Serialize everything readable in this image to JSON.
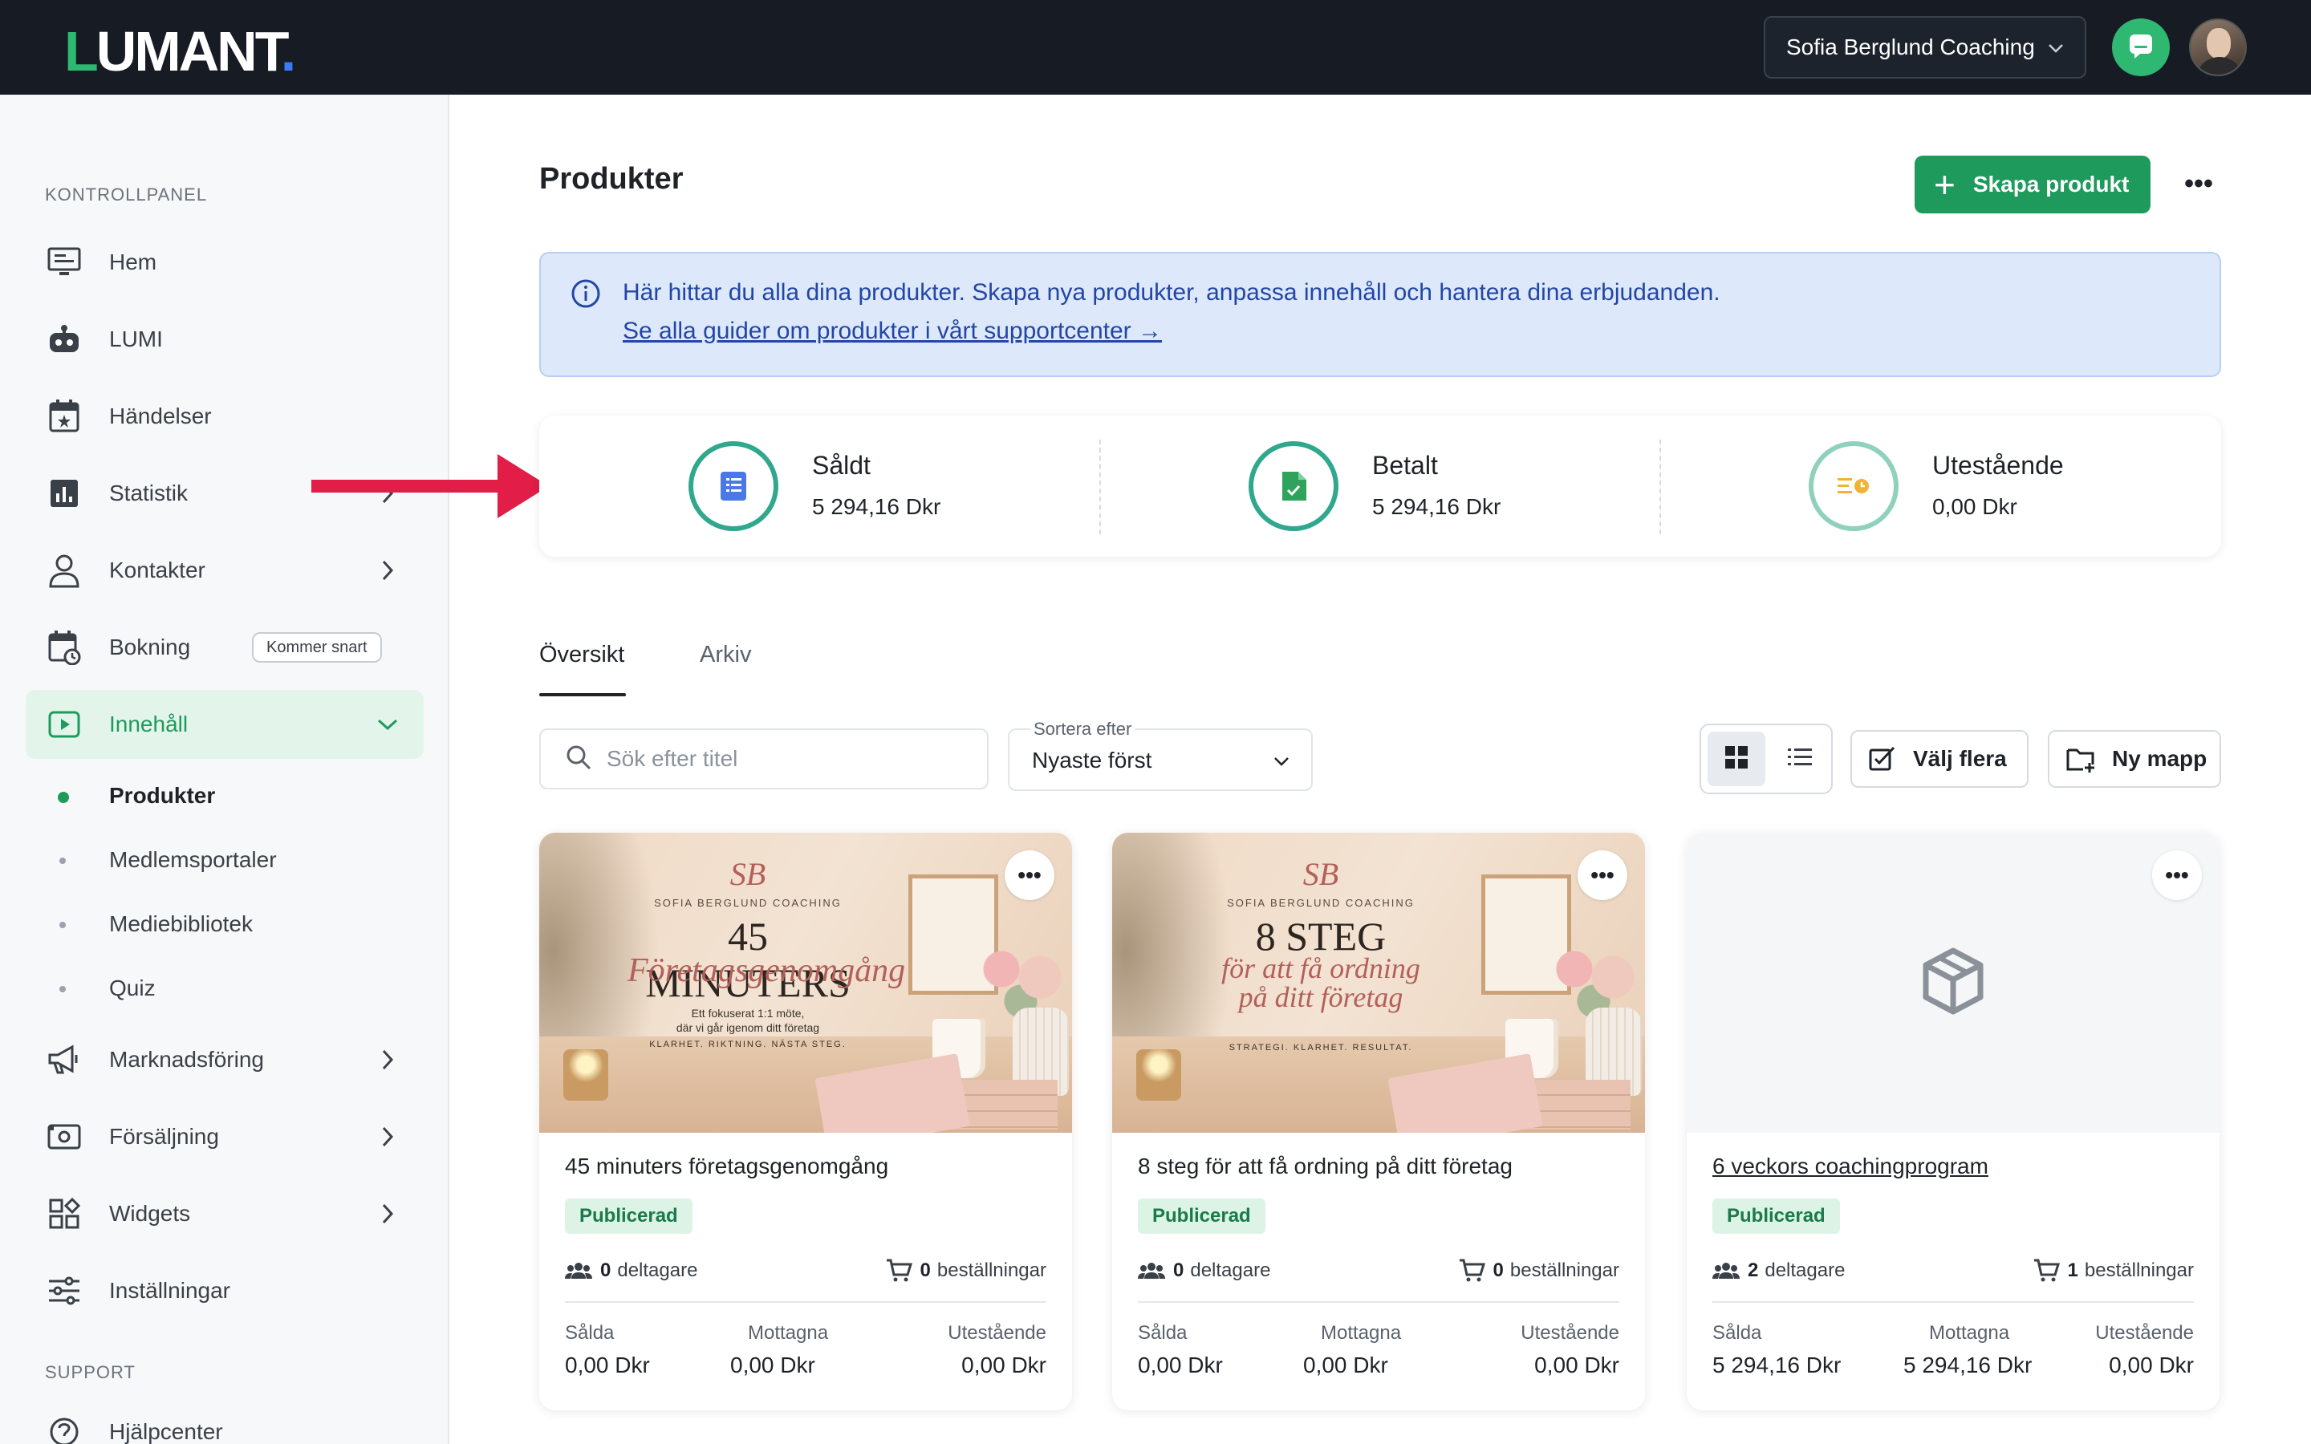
{
  "topbar": {
    "logo_letter_first": "L",
    "logo_letter_rest": "UMANT",
    "logo_dot": ".",
    "account_name": "Sofia Berglund Coaching",
    "icons": [
      "chevron-down-icon",
      "chat-icon",
      "avatar"
    ]
  },
  "sidebar": {
    "section_dashboard": "KONTROLLPANEL",
    "items": [
      {
        "label": "Hem",
        "icon": "monitor-icon"
      },
      {
        "label": "LUMI",
        "icon": "robot-icon"
      },
      {
        "label": "Händelser",
        "icon": "calendar-star-icon"
      },
      {
        "label": "Statistik",
        "icon": "bar-chart-icon"
      },
      {
        "label": "Kontakter",
        "icon": "user-icon"
      },
      {
        "label": "Bokning",
        "icon": "calendar-clock-icon",
        "badge": "Kommer snart"
      },
      {
        "label": "Innehåll",
        "icon": "play-square-icon"
      },
      {
        "label": "Marknadsföring",
        "icon": "megaphone-icon"
      },
      {
        "label": "Försäljning",
        "icon": "cash-icon"
      },
      {
        "label": "Widgets",
        "icon": "widgets-icon"
      },
      {
        "label": "Inställningar",
        "icon": "sliders-icon"
      }
    ],
    "sub_items": [
      "Produkter",
      "Medlemsportaler",
      "Mediebibliotek",
      "Quiz"
    ],
    "section_support": "SUPPORT",
    "support_items": [
      {
        "label": "Hjälpcenter",
        "icon": "help-icon"
      }
    ]
  },
  "main": {
    "title": "Produkter",
    "create_label": "Skapa produkt",
    "more_label": "•••",
    "info": {
      "message": "Här hittar du alla dina produkter. Skapa nya produkter, anpassa innehåll och hantera dina erbjudanden.",
      "link": "Se alla guider om produkter i vårt supportcenter →"
    },
    "stats": [
      {
        "label": "Såldt",
        "value": "5 294,16 Dkr",
        "icon": "receipt-icon"
      },
      {
        "label": "Betalt",
        "value": "5 294,16 Dkr",
        "icon": "paid-document-icon"
      },
      {
        "label": "Utestående",
        "value": "0,00 Dkr",
        "icon": "pending-list-icon"
      }
    ],
    "tabs": [
      "Översikt",
      "Arkiv"
    ],
    "search_placeholder": "Sök efter titel",
    "sort": {
      "label": "Sortera efter",
      "value": "Nyaste först"
    },
    "buttons": {
      "select_multiple": "Välj flera",
      "new_folder": "Ny mapp"
    },
    "colors": {
      "accent": "#1e9a5c",
      "topbar": "#171c24",
      "info_bg": "#dde9fb",
      "info_text": "#2346a6",
      "annotation_arrow": "#e11d48"
    }
  },
  "products": [
    {
      "title": "45 minuters företagsgenomgång",
      "status": "Publicerad",
      "participants_count": "0",
      "participants_label": "deltagare",
      "orders_count": "0",
      "orders_label": "beställningar",
      "sold_label": "Sålda",
      "sold": "0,00 Dkr",
      "received_label": "Mottagna",
      "received": "0,00 Dkr",
      "outstanding_label": "Utestående",
      "outstanding": "0,00 Dkr",
      "thumbnail": {
        "logo": "SB",
        "brand": "SOFIA BERGLUND COACHING",
        "heading": "45 MINUTERS",
        "script": "Företagsgenomgång",
        "caption_line1": "Ett fokuserat 1:1 möte,",
        "caption_line2": "där vi går igenom ditt företag",
        "tagline": "KLARHET. RIKTNING. NÄSTA STEG."
      }
    },
    {
      "title": "8 steg för att få ordning på ditt företag",
      "status": "Publicerad",
      "participants_count": "0",
      "participants_label": "deltagare",
      "orders_count": "0",
      "orders_label": "beställningar",
      "sold_label": "Sålda",
      "sold": "0,00 Dkr",
      "received_label": "Mottagna",
      "received": "0,00 Dkr",
      "outstanding_label": "Utestående",
      "outstanding": "0,00 Dkr",
      "thumbnail": {
        "logo": "SB",
        "brand": "SOFIA BERGLUND COACHING",
        "heading": "8 STEG",
        "script_line1": "för att få ordning",
        "script_line2": "på ditt företag",
        "tagline": "STRATEGI. KLARHET. RESULTAT."
      }
    },
    {
      "title": "6 veckors coachingprogram",
      "status": "Publicerad",
      "participants_count": "2",
      "participants_label": "deltagare",
      "orders_count": "1",
      "orders_label": "beställningar",
      "sold_label": "Sålda",
      "sold": "5 294,16 Dkr",
      "received_label": "Mottagna",
      "received": "5 294,16 Dkr",
      "outstanding_label": "Utestående",
      "outstanding": "0,00 Dkr",
      "thumbnail": {
        "icon": "package-icon"
      }
    }
  ]
}
